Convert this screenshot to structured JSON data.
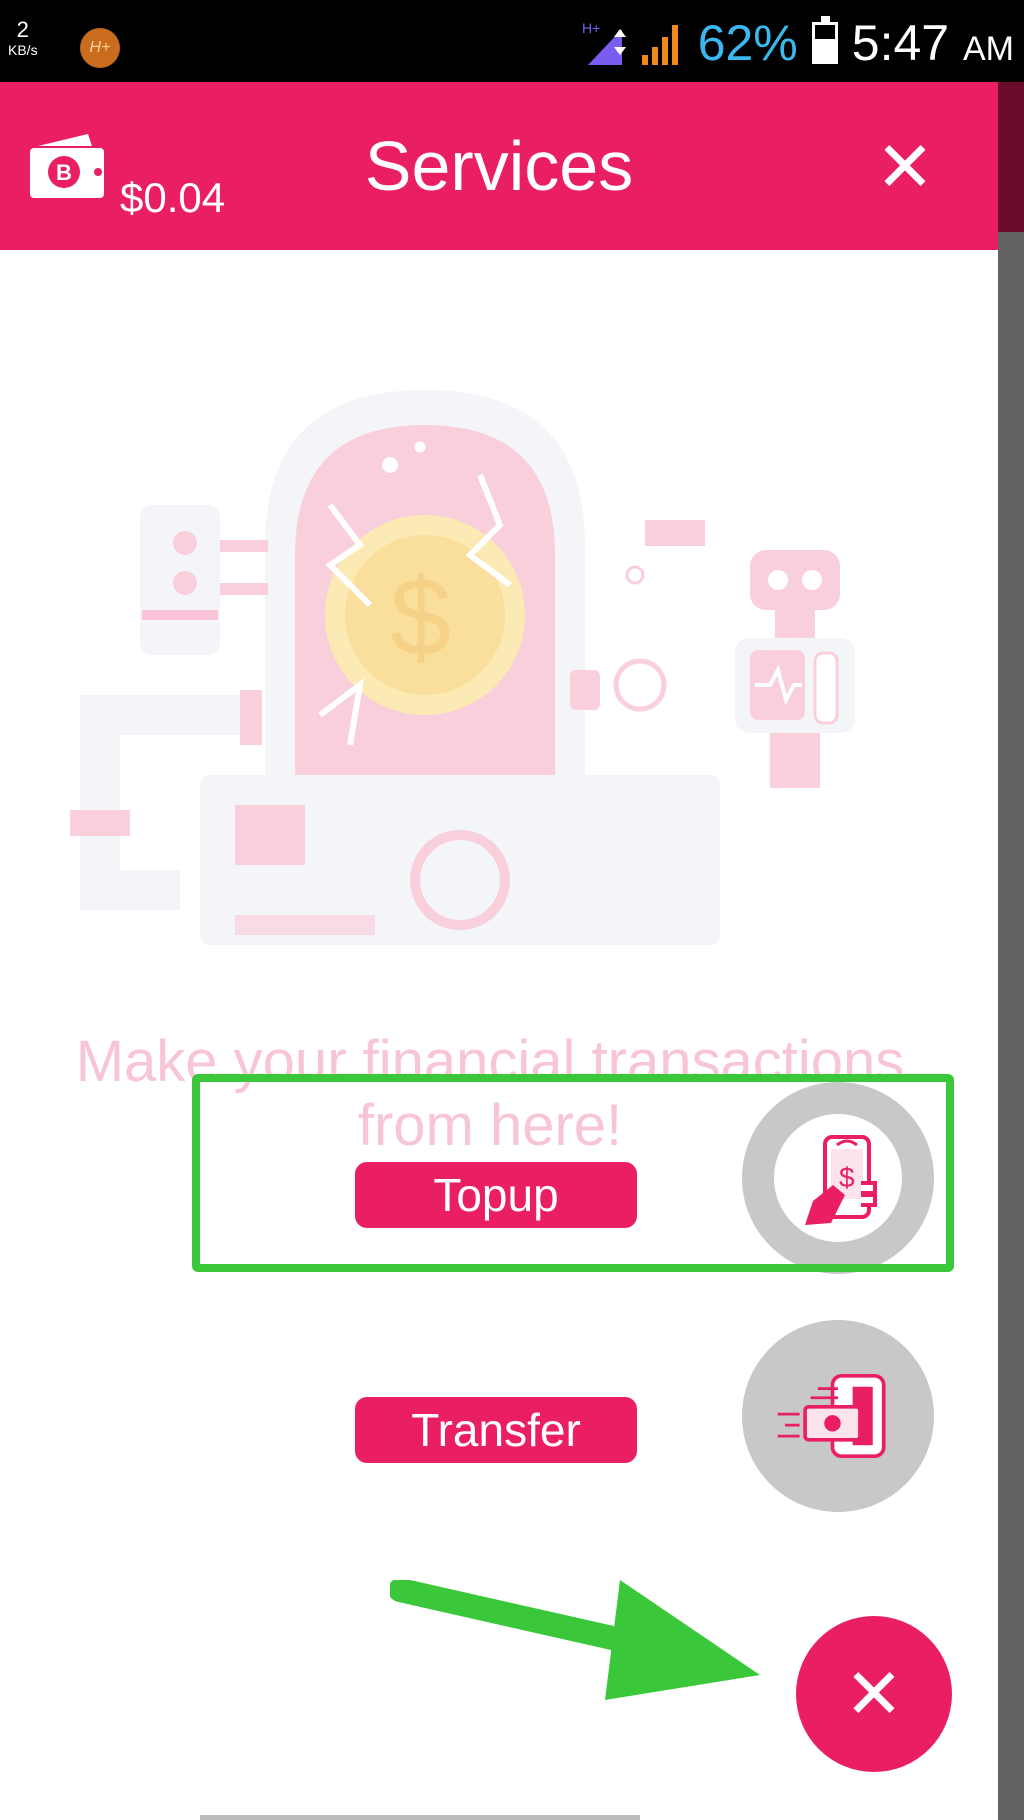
{
  "status_bar": {
    "net_speed": "2",
    "net_unit": "KB/s",
    "network_badge": "H+",
    "battery": "62%",
    "time": "5:47",
    "ampm": "AM"
  },
  "app_bar": {
    "balance": "$0.04",
    "title": "Services"
  },
  "content": {
    "tagline": "Make your financial transactions from here!"
  },
  "fab_menu": {
    "topup_label": "Topup",
    "transfer_label": "Transfer"
  },
  "colors": {
    "accent": "#ea1f63",
    "highlight": "#3ac83a"
  }
}
